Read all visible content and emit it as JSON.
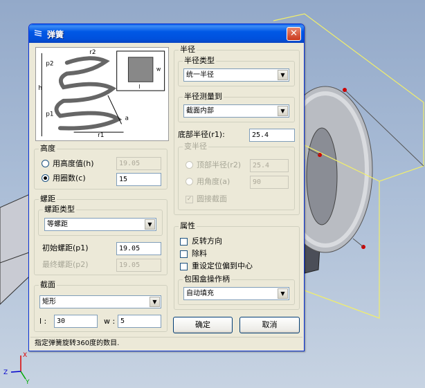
{
  "window": {
    "title": "弹簧",
    "close": "✕"
  },
  "height": {
    "group": "高度",
    "by_height": "用高度值(h)",
    "height_value": "19.05",
    "by_turns": "用圈数(c)",
    "turns_value": "15",
    "selected": "turns"
  },
  "pitch": {
    "group": "螺距",
    "type_group": "螺距类型",
    "type_value": "等螺距",
    "initial_label": "初始螺距(p1)",
    "initial_value": "19.05",
    "final_label": "最终螺距(p2)",
    "final_value": "19.05"
  },
  "section": {
    "group": "截面",
    "shape_value": "矩形",
    "l_label": "l :",
    "l_value": "30",
    "w_label": "w :",
    "w_value": "5"
  },
  "radius": {
    "group": "半径",
    "type_group": "半径类型",
    "type_value": "统一半径",
    "measure_group": "半径测量到",
    "measure_value": "截面内部",
    "bottom_label": "底部半径(r1):",
    "bottom_value": "25.4",
    "var_group": "变半径",
    "top_label": "顶部半径(r2)",
    "top_value": "25.4",
    "angle_label": "用角度(a)",
    "angle_value": "90",
    "round_label": "圆接截面"
  },
  "props": {
    "group": "属性",
    "reverse": "反转方向",
    "remove": "除料",
    "recenter": "重设定位偏到中心",
    "bbox_group": "包围盒操作柄",
    "bbox_value": "自动填充"
  },
  "buttons": {
    "ok": "确定",
    "cancel": "取消"
  },
  "status": "指定弹簧旋转360度的数目.",
  "diagram": {
    "labels": [
      "r2",
      "p2",
      "h",
      "p1",
      "r1",
      "a",
      "w",
      "l"
    ]
  },
  "axes": {
    "x": "X",
    "y": "Y",
    "z": "Z"
  },
  "colors": {
    "title_blue": "#0054e3",
    "dialog_bg": "#ece9d8",
    "close_red": "#c9391f"
  }
}
